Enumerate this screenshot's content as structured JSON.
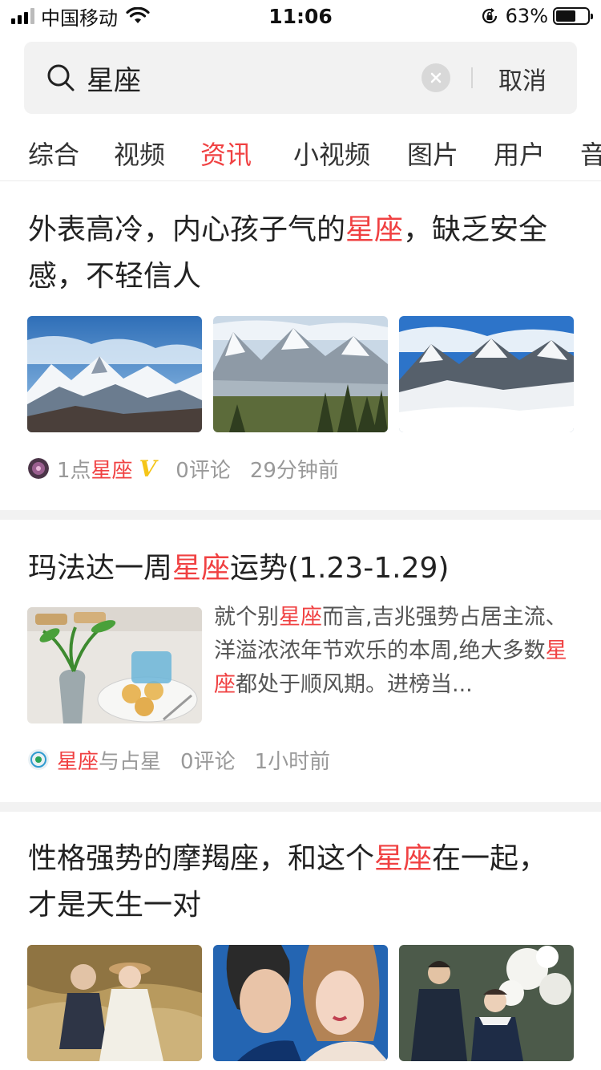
{
  "status": {
    "carrier": "中国移动",
    "time": "11:06",
    "battery_pct": "63%",
    "battery_level": 0.63
  },
  "search": {
    "query": "星座",
    "cancel_label": "取消"
  },
  "tabs": [
    {
      "label": "综合"
    },
    {
      "label": "视频"
    },
    {
      "label": "资讯",
      "active": true
    },
    {
      "label": "小视频"
    },
    {
      "label": "图片"
    },
    {
      "label": "用户"
    },
    {
      "label": "音"
    }
  ],
  "highlight_color": "#f04142",
  "articles": [
    {
      "title_parts": [
        "外表高冷，内心孩子气的",
        "星座",
        "，缺乏安全感，不轻信人"
      ],
      "source_parts": [
        "1点",
        "星座"
      ],
      "verified": "V",
      "comments": "0评论",
      "time": "29分钟前",
      "images": [
        "snowy-mountain-blue-sky",
        "mountain-lake-forest",
        "snow-valley-peaks"
      ]
    },
    {
      "title_parts": [
        "玛法达一周",
        "星座",
        "运势(1.23-1.29)"
      ],
      "summary_parts": [
        "就个别",
        "星座",
        "而言,吉兆强势占居主流、洋溢浓浓年节欢乐的本周,绝大多数",
        "星座",
        "都处于顺风期。进榜当..."
      ],
      "source_parts": [
        "星座",
        "与占星"
      ],
      "comments": "0评论",
      "time": "1小时前",
      "images": [
        "plant-vase-pastries"
      ]
    },
    {
      "title_parts": [
        "性格强势的摩羯座，和这个",
        "星座",
        "在一起，才是天生一对"
      ],
      "images": [
        "couple-grass-field",
        "couple-portrait-blue",
        "couple-flowers"
      ]
    }
  ]
}
